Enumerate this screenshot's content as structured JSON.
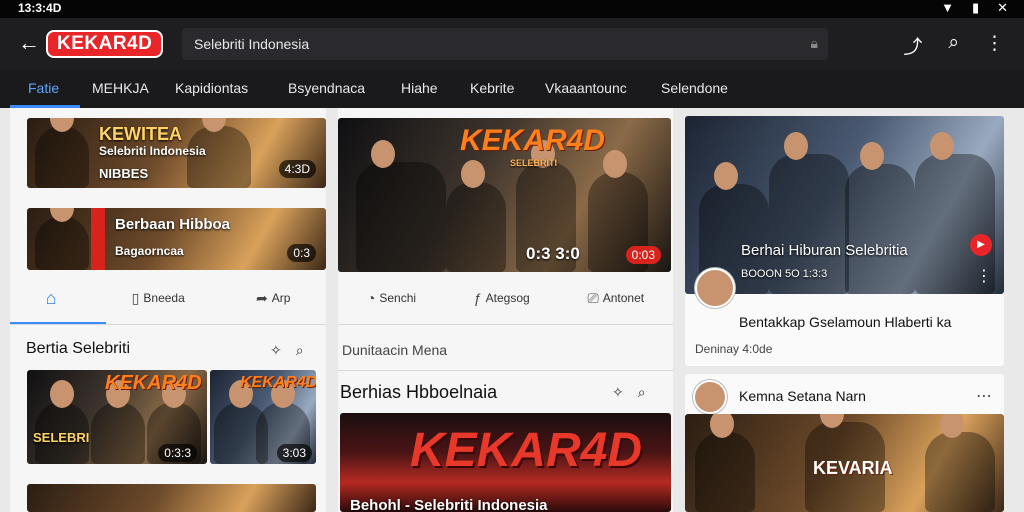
{
  "status": {
    "time": "13:3:4D"
  },
  "appbar": {
    "logo": "KEKAR4D",
    "search_text": "Selebriti Indonesia"
  },
  "tabs": [
    "Fatie",
    "MEHKJA",
    "Kapidiontas",
    "Bsyendnaca",
    "Hiahe",
    "Kebrite",
    "Vkaaantounc",
    "Selendone"
  ],
  "col1": {
    "thumb1": {
      "title_1": "KEWITEA",
      "title_2": "Selebriti Indonesia",
      "title_3": "NIBBES",
      "duration": "4:3D"
    },
    "thumb2": {
      "title_1": "Berbaan Hibboa",
      "title_2": "Bagaorncaa",
      "duration": "0:3"
    },
    "actions": [
      "",
      "Bneeda",
      "Arp"
    ],
    "section_title": "Bertia Selebriti",
    "mini1": {
      "brand": "KEKAR4D",
      "title": "SELEBRI",
      "duration": "0:3:3"
    },
    "mini2": {
      "brand": "KEKAR4D",
      "duration": "3:03"
    }
  },
  "col2": {
    "thumb1": {
      "brand": "KEKAR4D",
      "sub": "SELEBRITI",
      "badge": "0:3 3:0",
      "duration": "0:03"
    },
    "actions": [
      "Senchi",
      "Ategsog",
      "Antonet"
    ],
    "subtitle": "Dunitaacin Mena",
    "section_title": "Berhias Hbboelnaia",
    "thumb2": {
      "brand": "KEKAR4D",
      "title": "Behohl - Selebriti Indonesia"
    }
  },
  "col3": {
    "card1": {
      "title": "Berhai Hiburan Selebritia",
      "meta": "BOOON 5O 1:3:3",
      "caption": "Bentakkap Gselamoun Hlaberti ka",
      "sub": "Deninay 4:0de"
    },
    "card2": {
      "title": "Kemna Setana Narn",
      "brand": "KEVARIA"
    }
  }
}
